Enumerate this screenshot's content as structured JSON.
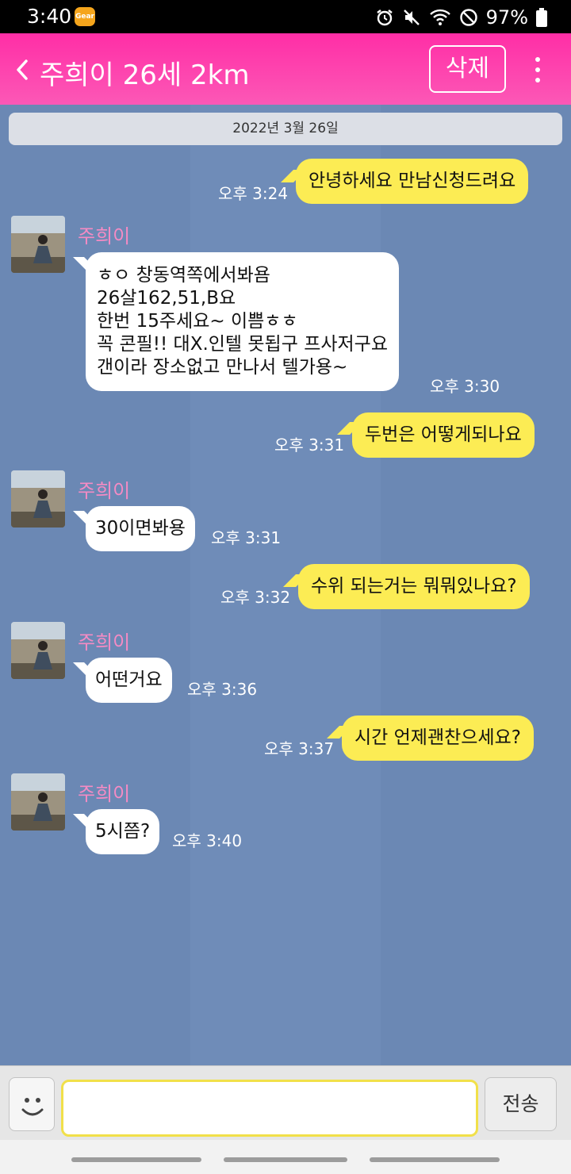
{
  "status_bar": {
    "time": "3:40",
    "app_badge": "Gear",
    "battery": "97%"
  },
  "header": {
    "title": "주희이 26세 2km",
    "delete_label": "삭제"
  },
  "chat": {
    "date": "2022년 3월 26일",
    "messages": [
      {
        "from": "me",
        "text": "안녕하세요 만남신청드려요",
        "time": "오후 3:24"
      },
      {
        "from": "them",
        "sender": "주희이",
        "text": "ㅎㅇ 창동역쪽에서봐욤\n26살162,51,B요\n한번 15주세요~ 이쁨ㅎㅎ\n꼭 콘필!! 대X.인텔 못됩구 프사저구요\n갠이라 장소없고 만나서 텔가용~",
        "time": "오후 3:30"
      },
      {
        "from": "me",
        "text": "두번은 어떻게되나요",
        "time": "오후 3:31"
      },
      {
        "from": "them",
        "sender": "주희이",
        "text": "30이면봐용",
        "time": "오후 3:31"
      },
      {
        "from": "me",
        "text": "수위 되는거는 뭐뭐있나요?",
        "time": "오후 3:32"
      },
      {
        "from": "them",
        "sender": "주희이",
        "text": "어떤거요",
        "time": "오후 3:36"
      },
      {
        "from": "me",
        "text": "시간 언제괜찬으세요?",
        "time": "오후 3:37"
      },
      {
        "from": "them",
        "sender": "주희이",
        "text": "5시쯤?",
        "time": "오후 3:40"
      }
    ]
  },
  "input_bar": {
    "message_value": "",
    "send_label": "전송"
  },
  "icons": {
    "back": "chevron-left-icon",
    "more": "more-vertical-icon",
    "emoji": "smiley-icon",
    "alarm": "alarm-icon",
    "mute": "mute-icon",
    "wifi": "wifi-icon",
    "dnd": "do-not-disturb-icon",
    "battery": "battery-icon"
  },
  "colors": {
    "header": "#fc3aaa",
    "chat_background": "#6b88b4",
    "my_bubble": "#fcec54",
    "their_bubble": "#ffffff",
    "sender_name": "#f58bc4"
  }
}
